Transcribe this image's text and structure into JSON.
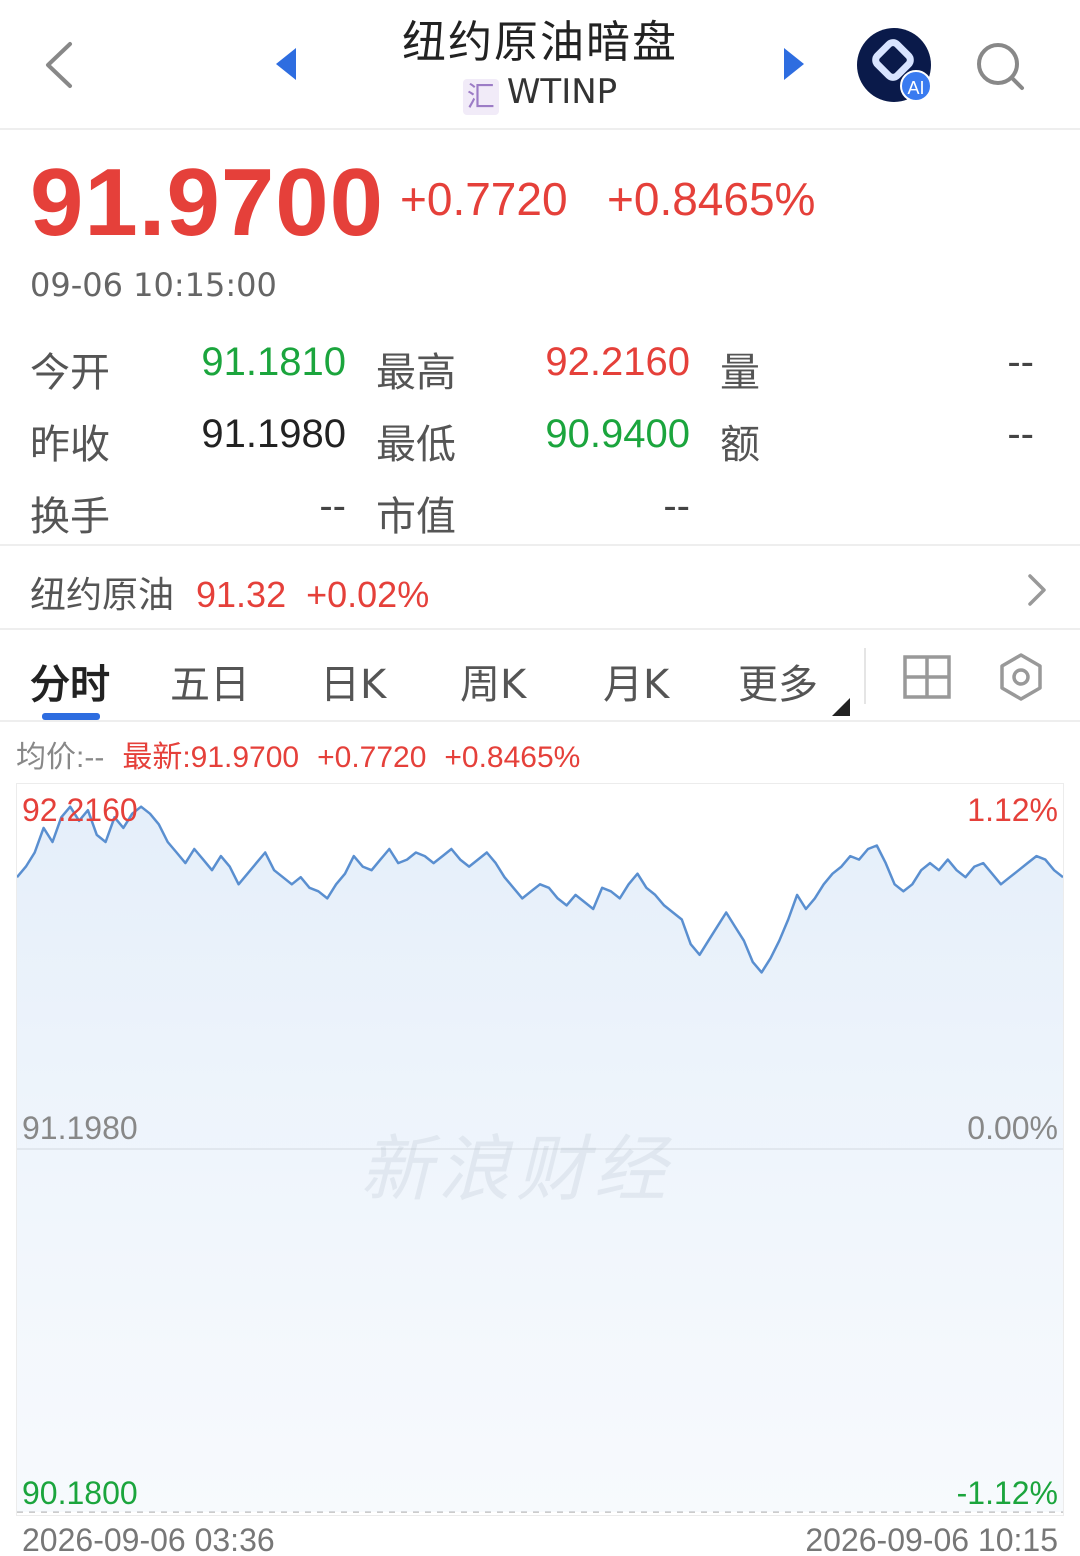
{
  "header": {
    "title": "纽约原油暗盘",
    "exchange_badge": "汇",
    "symbol": "WTINP",
    "ai_badge": "AI"
  },
  "quote": {
    "price": "91.9700",
    "change": "+0.7720",
    "change_pct": "+0.8465%",
    "time": "09-06 10:15:00"
  },
  "stats": [
    {
      "label": "今开",
      "value": "91.1810",
      "color": "green"
    },
    {
      "label": "最高",
      "value": "92.2160",
      "color": "red"
    },
    {
      "label": "量",
      "value": "--",
      "color": "grey"
    },
    {
      "label": "昨收",
      "value": "91.1980",
      "color": "dark"
    },
    {
      "label": "最低",
      "value": "90.9400",
      "color": "green"
    },
    {
      "label": "额",
      "value": "--",
      "color": "grey"
    },
    {
      "label": "换手",
      "value": "--",
      "color": "grey"
    },
    {
      "label": "市值",
      "value": "--",
      "color": "grey"
    }
  ],
  "related": {
    "name": "纽约原油",
    "price": "91.32",
    "change_pct": "+0.02%"
  },
  "tabs": [
    {
      "label": "分时",
      "active": true
    },
    {
      "label": "五日",
      "active": false
    },
    {
      "label": "日K",
      "active": false
    },
    {
      "label": "周K",
      "active": false
    },
    {
      "label": "月K",
      "active": false
    },
    {
      "label": "更多",
      "active": false
    }
  ],
  "toolbar_icons": [
    "grid-layout-icon",
    "settings-hexagon-icon"
  ],
  "chart_info": {
    "avg": "均价:--",
    "latest": "最新:91.9700",
    "change": "+0.7720",
    "change_pct": "+0.8465%"
  },
  "colors": {
    "up": "#e5403a",
    "down": "#1ba53d",
    "line": "#5a8fd0",
    "accent": "#2e6de0"
  },
  "watermark": "新浪财经",
  "chart_data": {
    "type": "line",
    "title": "",
    "xlabel": "",
    "ylabel": "",
    "x_start": "2026-09-06 03:36",
    "x_end": "2026-09-06 10:15",
    "ylim": [
      90.18,
      92.216
    ],
    "y_labels_left": [
      "92.2160",
      "91.1980",
      "90.1800"
    ],
    "y_labels_right": [
      "1.12%",
      "0.00%",
      "-1.12%"
    ],
    "prev_close": 91.198,
    "grid": true,
    "series": [
      {
        "values": [
          91.98,
          92.01,
          92.05,
          92.12,
          92.08,
          92.15,
          92.18,
          92.14,
          92.17,
          92.1,
          92.08,
          92.15,
          92.12,
          92.16,
          92.18,
          92.16,
          92.13,
          92.08,
          92.05,
          92.02,
          92.06,
          92.03,
          92.0,
          92.04,
          92.01,
          91.96,
          91.99,
          92.02,
          92.05,
          92.0,
          91.98,
          91.96,
          91.98,
          91.95,
          91.94,
          91.92,
          91.96,
          91.99,
          92.04,
          92.01,
          92.0,
          92.03,
          92.06,
          92.02,
          92.03,
          92.05,
          92.04,
          92.02,
          92.04,
          92.06,
          92.03,
          92.01,
          92.03,
          92.05,
          92.02,
          91.98,
          91.95,
          91.92,
          91.94,
          91.96,
          91.95,
          91.92,
          91.9,
          91.93,
          91.91,
          91.89,
          91.95,
          91.94,
          91.92,
          91.96,
          91.99,
          91.95,
          91.93,
          91.9,
          91.88,
          91.86,
          91.79,
          91.76,
          91.8,
          91.84,
          91.88,
          91.84,
          91.8,
          91.74,
          91.71,
          91.75,
          91.8,
          91.86,
          91.93,
          91.89,
          91.92,
          91.96,
          91.99,
          92.01,
          92.04,
          92.03,
          92.06,
          92.07,
          92.02,
          91.96,
          91.94,
          91.96,
          92.0,
          92.02,
          92.0,
          92.03,
          92.0,
          91.98,
          92.01,
          92.02,
          91.99,
          91.96,
          91.98,
          92.0,
          92.02,
          92.04,
          92.03,
          92.0,
          91.98
        ]
      }
    ]
  }
}
